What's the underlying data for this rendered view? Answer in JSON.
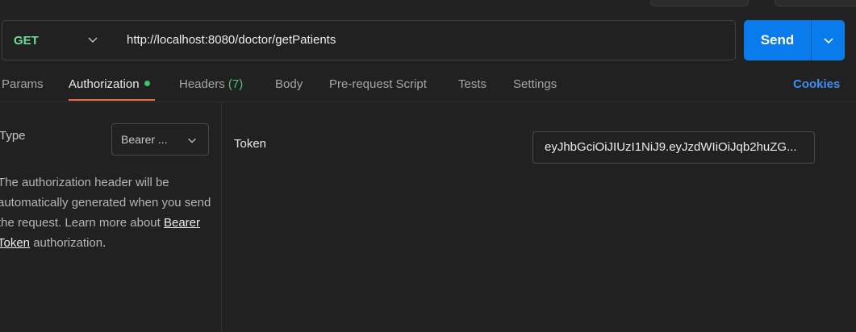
{
  "request": {
    "method": "GET",
    "url": "http://localhost:8080/doctor/getPatients",
    "send_label": "Send"
  },
  "tabs": [
    {
      "label": "Params"
    },
    {
      "label": "Authorization"
    },
    {
      "label": "Headers",
      "count": "(7)"
    },
    {
      "label": "Body"
    },
    {
      "label": "Pre-request Script"
    },
    {
      "label": "Tests"
    },
    {
      "label": "Settings"
    }
  ],
  "cookies_label": "Cookies",
  "auth": {
    "type_label": "Type",
    "selected_type": "Bearer ...",
    "description_prefix": "The authorization header will be automatically generated when you send the request. Learn more about",
    "link_text": "Bearer Token",
    "description_suffix": "authorization",
    "description_end": ".",
    "token_label": "Token",
    "token_value": "eyJhbGciOiJIUzI1NiJ9.eyJzdWIiOiJqb2huZG..."
  },
  "colors": {
    "accent": "#097bed",
    "method_get": "#6bdd9a",
    "active_tab_underline": "#f26b3a",
    "link": "#3d8fef"
  }
}
